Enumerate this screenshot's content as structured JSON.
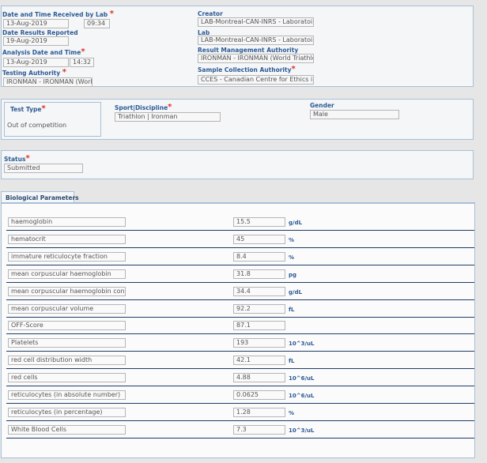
{
  "section1": {
    "date_received_label": "Date and Time Received by Lab",
    "date_received": "13-Aug-2019",
    "time_received": "09:34",
    "date_results_label": "Date Results Reported",
    "date_results": "19-Aug-2019",
    "analysis_label": "Analysis Date and Time",
    "analysis_date": "13-Aug-2019",
    "analysis_time": "14:32",
    "testing_authority_label": "Testing Authority",
    "testing_authority": "IRONMAN - IRONMAN (World Triathlon Corporation)",
    "creator_label": "Creator",
    "creator": "LAB-Montreal-CAN-INRS - Laboratoire de contrôle du dopage INRS",
    "lab_label": "Lab",
    "lab": "LAB-Montreal-CAN-INRS - Laboratoire de contrôle du dopage INRS",
    "rma_label": "Result Management Authority",
    "rma": "IRONMAN - IRONMAN (World Triathlon Corporation)",
    "sca_label": "Sample Collection Authority",
    "sca": "CCES - Canadian Centre for Ethics in Sport"
  },
  "section2": {
    "test_type_label": "Test Type",
    "test_type": "Out of competition",
    "sport_label": "Sport|Discipline",
    "sport": "Triathlon | Ironman",
    "gender_label": "Gender",
    "gender": "Male"
  },
  "section3": {
    "status_label": "Status",
    "status": "Submitted"
  },
  "bio": {
    "tab_label": "Biological Parameters",
    "rows": [
      {
        "name": "haemoglobin",
        "value": "15.5",
        "unit": "g/dL"
      },
      {
        "name": "hematocrit",
        "value": "45",
        "unit": "%"
      },
      {
        "name": "immature reticulocyte fraction",
        "value": "8.4",
        "unit": "%"
      },
      {
        "name": "mean corpuscular haemoglobin",
        "value": "31.8",
        "unit": "pg"
      },
      {
        "name": "mean corpuscular haemoglobin concentration",
        "value": "34.4",
        "unit": "g/dL"
      },
      {
        "name": "mean corpuscular volume",
        "value": "92.2",
        "unit": "fL"
      },
      {
        "name": "OFF-Score",
        "value": "87.1",
        "unit": ""
      },
      {
        "name": "Platelets",
        "value": "193",
        "unit": "10^3/uL"
      },
      {
        "name": "red cell distribution width",
        "value": "42.1",
        "unit": "fL"
      },
      {
        "name": "red cells",
        "value": "4.88",
        "unit": "10^6/uL"
      },
      {
        "name": "reticulocytes (in absolute number)",
        "value": "0.0625",
        "unit": "10^6/uL"
      },
      {
        "name": "reticulocytes (in percentage)",
        "value": "1.28",
        "unit": "%"
      },
      {
        "name": "White Blood Cells",
        "value": "7.3",
        "unit": "10^3/uL"
      }
    ]
  }
}
